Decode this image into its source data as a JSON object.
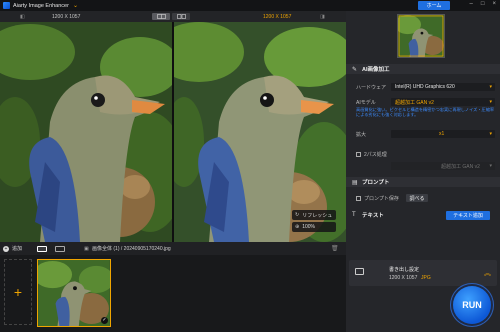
{
  "app": {
    "title": "Aiarty Image Enhancer",
    "home_label": "ホーム"
  },
  "imagebar": {
    "original_size": "1200 X 1057",
    "output_size": "1200 X 1057"
  },
  "preview": {
    "refresh_label": "リフレッシュ",
    "zoom_label": "100%"
  },
  "thumbbar": {
    "add_label": "追加",
    "path_label": "画像全体 (1) / 20240905170240.jpg"
  },
  "panel": {
    "ai_section": "AI画像加工",
    "hardware_label": "ハードウェア",
    "hardware_value": "Intel(R) UHD Graphics 620",
    "ai_model_label": "AIモデル",
    "ai_model_value": "超越加工 GAN v2",
    "model_desc": "高画質化に強い。ピクセルと構造を精密かつ忠実に再現しノイズ・圧縮率による劣化にも強く対応します。",
    "scale_label": "拡大",
    "scale_value": "x1",
    "two_pass_label": "2パス処理",
    "two_pass_value": "超越加工 GAN v2",
    "prompt_section": "プロンプト",
    "prompt_save_label": "プロンプト保存",
    "prompt_browse_label": "調べる",
    "text_section": "テキスト",
    "add_text_label": "テキスト追加"
  },
  "export": {
    "title": "書き出し設定",
    "size": "1200 X 1057",
    "format": "JPG"
  },
  "run_label": "RUN",
  "colors": {
    "accent": "#f0a500",
    "primary": "#1f6fe0"
  }
}
